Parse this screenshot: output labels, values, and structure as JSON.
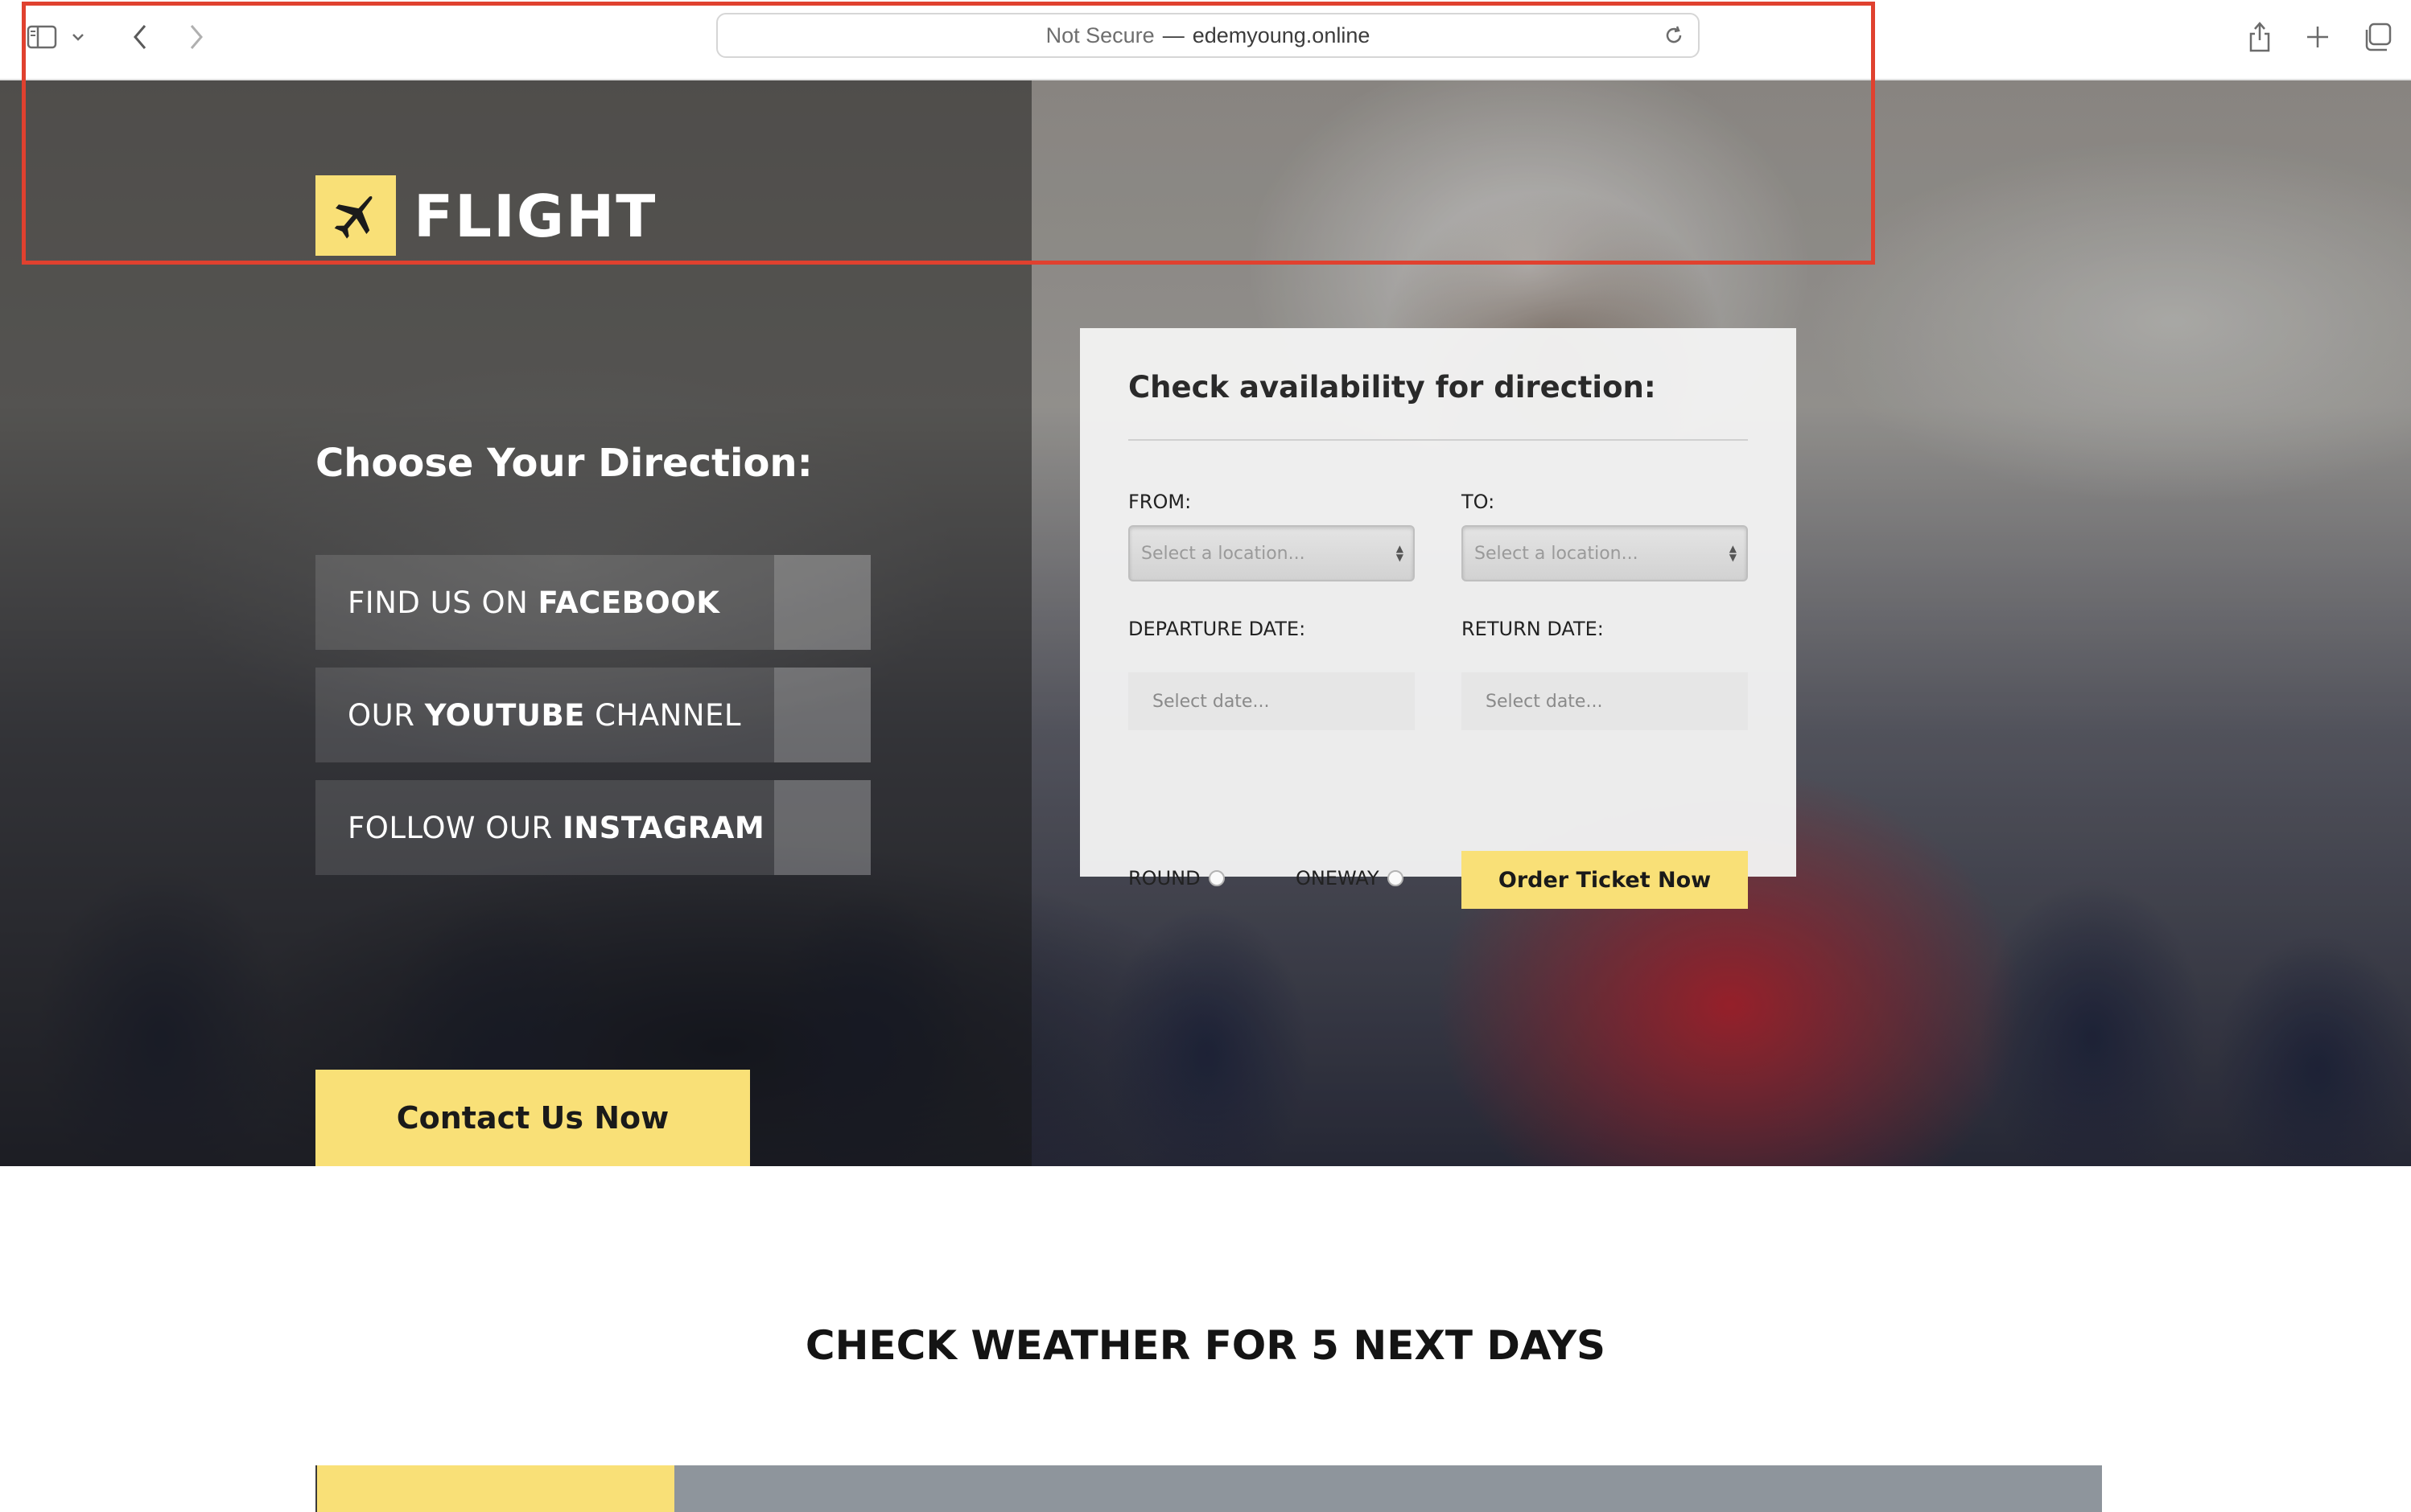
{
  "browser": {
    "security_label": "Not Secure",
    "separator": "—",
    "domain": "edemyoung.online",
    "icons": [
      "sidebar-icon",
      "chevron-down-icon",
      "back-icon",
      "forward-icon",
      "reload-icon",
      "share-icon",
      "new-tab-icon",
      "tabs-overview-icon"
    ]
  },
  "hero": {
    "brand": "FLIGHT",
    "choose_title": "Choose Your Direction:",
    "social": [
      {
        "prefix": "FIND US ON ",
        "bold": "FACEBOOK",
        "suffix": ""
      },
      {
        "prefix": "OUR ",
        "bold": "YOUTUBE",
        "suffix": " CHANNEL"
      },
      {
        "prefix": "FOLLOW OUR ",
        "bold": "INSTAGRAM",
        "suffix": ""
      }
    ],
    "contact_button": "Contact Us Now"
  },
  "booking": {
    "title": "Check availability for direction:",
    "from_label": "FROM:",
    "to_label": "TO:",
    "from_placeholder": "Select a location...",
    "to_placeholder": "Select a location...",
    "departure_label": "DEPARTURE DATE:",
    "return_label": "RETURN DATE:",
    "departure_placeholder": "Select date...",
    "return_placeholder": "Select date...",
    "round_label": "ROUND",
    "oneway_label": "ONEWAY",
    "order_button": "Order Ticket Now"
  },
  "weather": {
    "title": "CHECK WEATHER FOR 5 NEXT DAYS"
  },
  "colors": {
    "accent_yellow": "#f9e077",
    "highlight_red": "#e0412f",
    "weather_gray": "#8e959c"
  }
}
